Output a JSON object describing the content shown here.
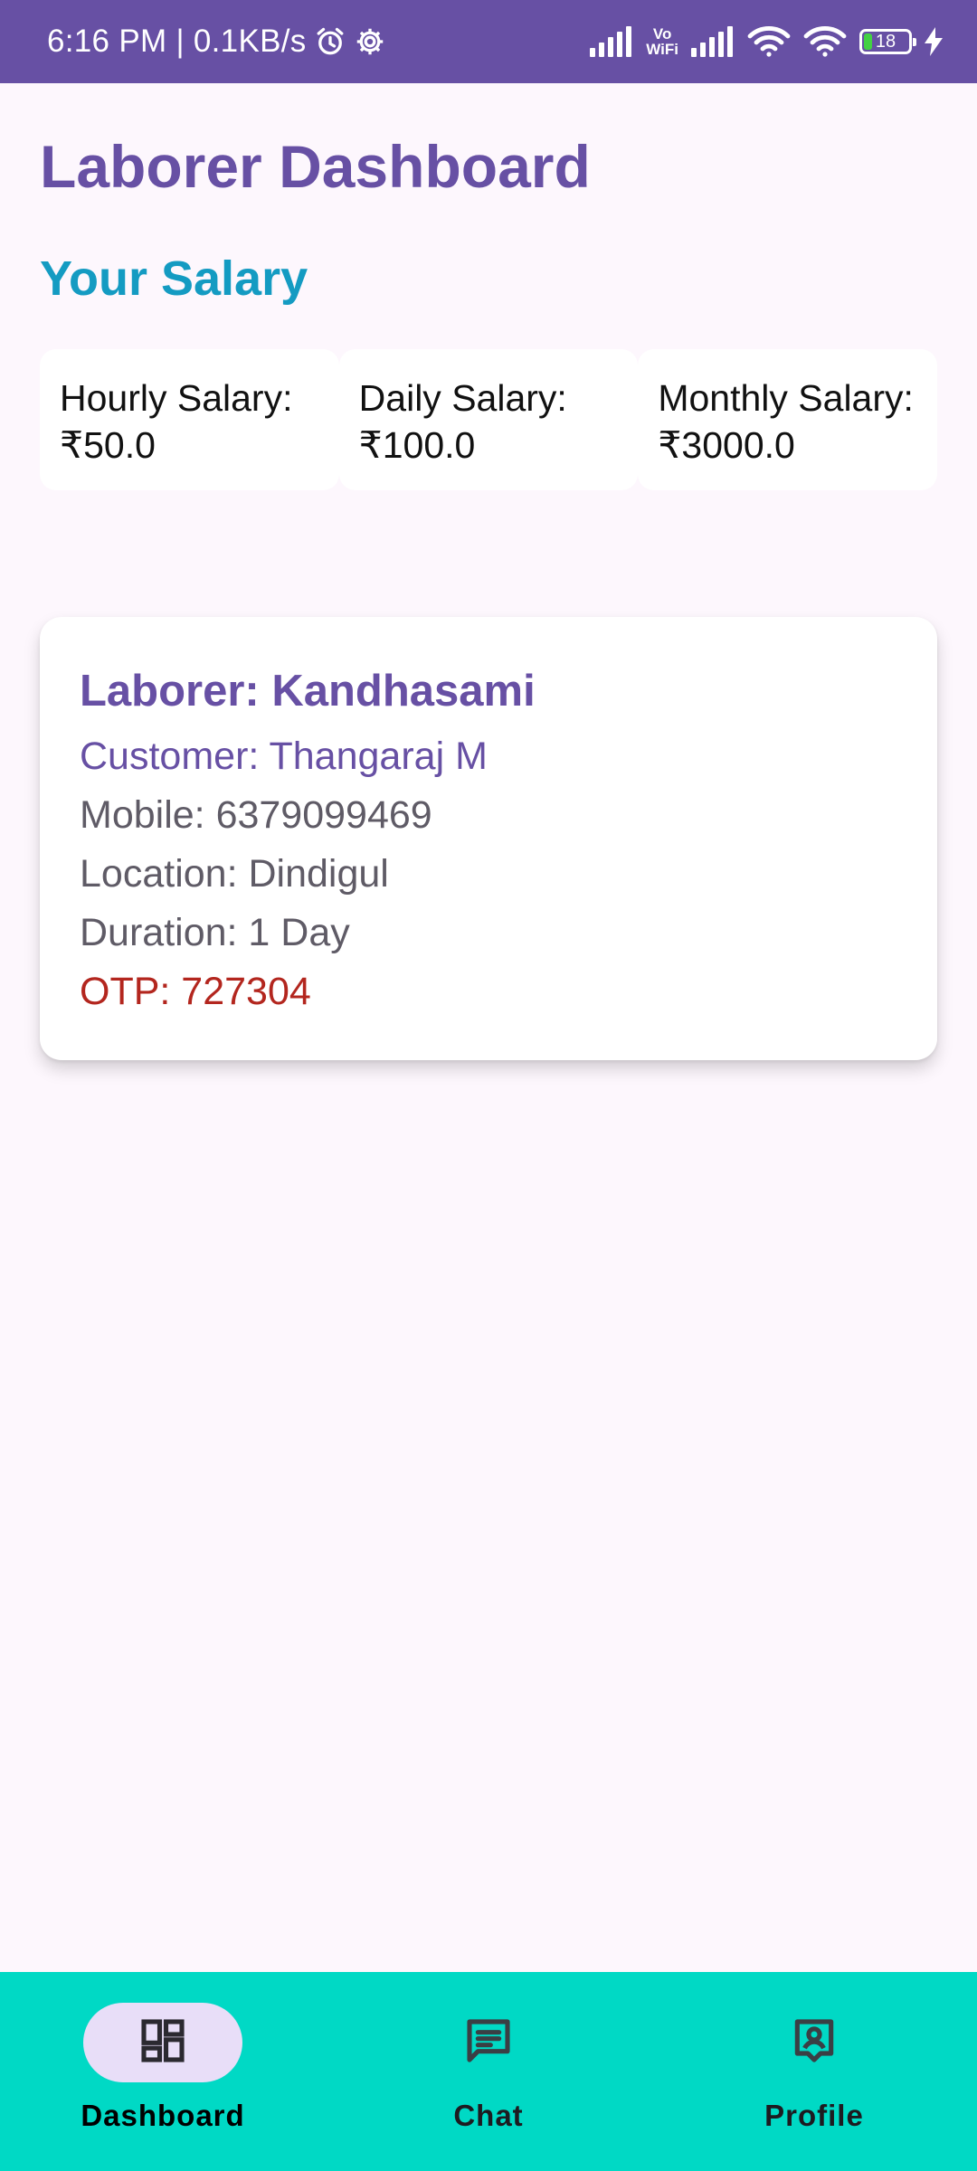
{
  "status_bar": {
    "time_speed": "6:16 PM | 0.1KB/s",
    "vowifi_top": "Vo",
    "vowifi_bottom": "WiFi",
    "battery_level": "18",
    "battery_fraction": 0.18,
    "icons": [
      "alarm-icon",
      "settings-icon",
      "signal-icon",
      "vowifi-icon",
      "signal-icon",
      "wifi-icon",
      "wifi-icon",
      "battery-icon",
      "charging-icon"
    ]
  },
  "page": {
    "title": "Laborer Dashboard",
    "salary_section_title": "Your Salary"
  },
  "salary": {
    "hourly": "Hourly Salary: ₹50.0",
    "daily": "Daily Salary: ₹100.0",
    "monthly": "Monthly Salary: ₹3000.0"
  },
  "booking": {
    "laborer": "Laborer: Kandhasami",
    "customer": "Customer: Thangaraj M",
    "mobile": "Mobile: 6379099469",
    "location": "Location: Dindigul",
    "duration": "Duration: 1 Day",
    "otp": "OTP: 727304"
  },
  "nav": {
    "items": [
      {
        "label": "Dashboard",
        "icon": "dashboard-icon",
        "active": true
      },
      {
        "label": "Chat",
        "icon": "chat-icon",
        "active": false
      },
      {
        "label": "Profile",
        "icon": "profile-icon",
        "active": false
      }
    ]
  },
  "colors": {
    "status_bar": "#6750a4",
    "title": "#6750a4",
    "section_title": "#149bc2",
    "background": "#fdf7fd",
    "otp": "#b3261e",
    "nav_background": "#00d9c5",
    "nav_active_pill": "#e8def8"
  }
}
